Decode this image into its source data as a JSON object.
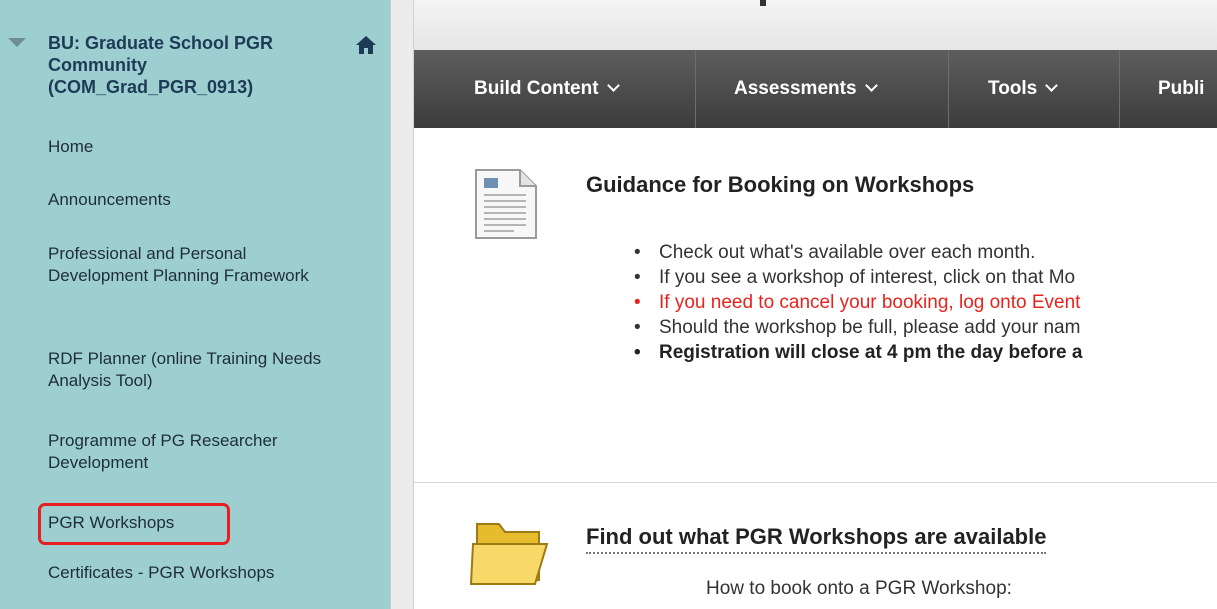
{
  "sidebar": {
    "course_title": "BU: Graduate School PGR Community (COM_Grad_PGR_0913)",
    "items": [
      {
        "label": "Home"
      },
      {
        "label": "Announcements"
      },
      {
        "label": "Professional and Personal Development Planning Framework"
      },
      {
        "label": "RDF Planner (online Training Needs Analysis Tool)"
      },
      {
        "label": "Programme of PG Researcher Development"
      },
      {
        "label": "PGR Workshops"
      },
      {
        "label": "Certificates - PGR Workshops"
      }
    ]
  },
  "toolbar": {
    "buttons": [
      {
        "label": "Build Content"
      },
      {
        "label": "Assessments"
      },
      {
        "label": "Tools"
      },
      {
        "label": "Publi"
      }
    ]
  },
  "content": {
    "item1": {
      "title": "Guidance for Booking on Workshops",
      "bullets": [
        {
          "text": "Check out what's available over each month."
        },
        {
          "text": "If you see a workshop of interest, click on that Mo"
        },
        {
          "text": "If you need to cancel your booking, log onto Event"
        },
        {
          "text": "Should the workshop be full, please add your nam"
        },
        {
          "text": "Registration will close at 4 pm the day before a"
        }
      ]
    },
    "item2": {
      "title": "Find out what PGR Workshops are available",
      "subtitle": "How to book onto a PGR Workshop:"
    }
  },
  "colors": {
    "sidebar_bg": "#9dcfd0",
    "toolbar_bg": "#4a4a4a",
    "highlight": "#e81e25",
    "red_text": "#e8231e"
  }
}
